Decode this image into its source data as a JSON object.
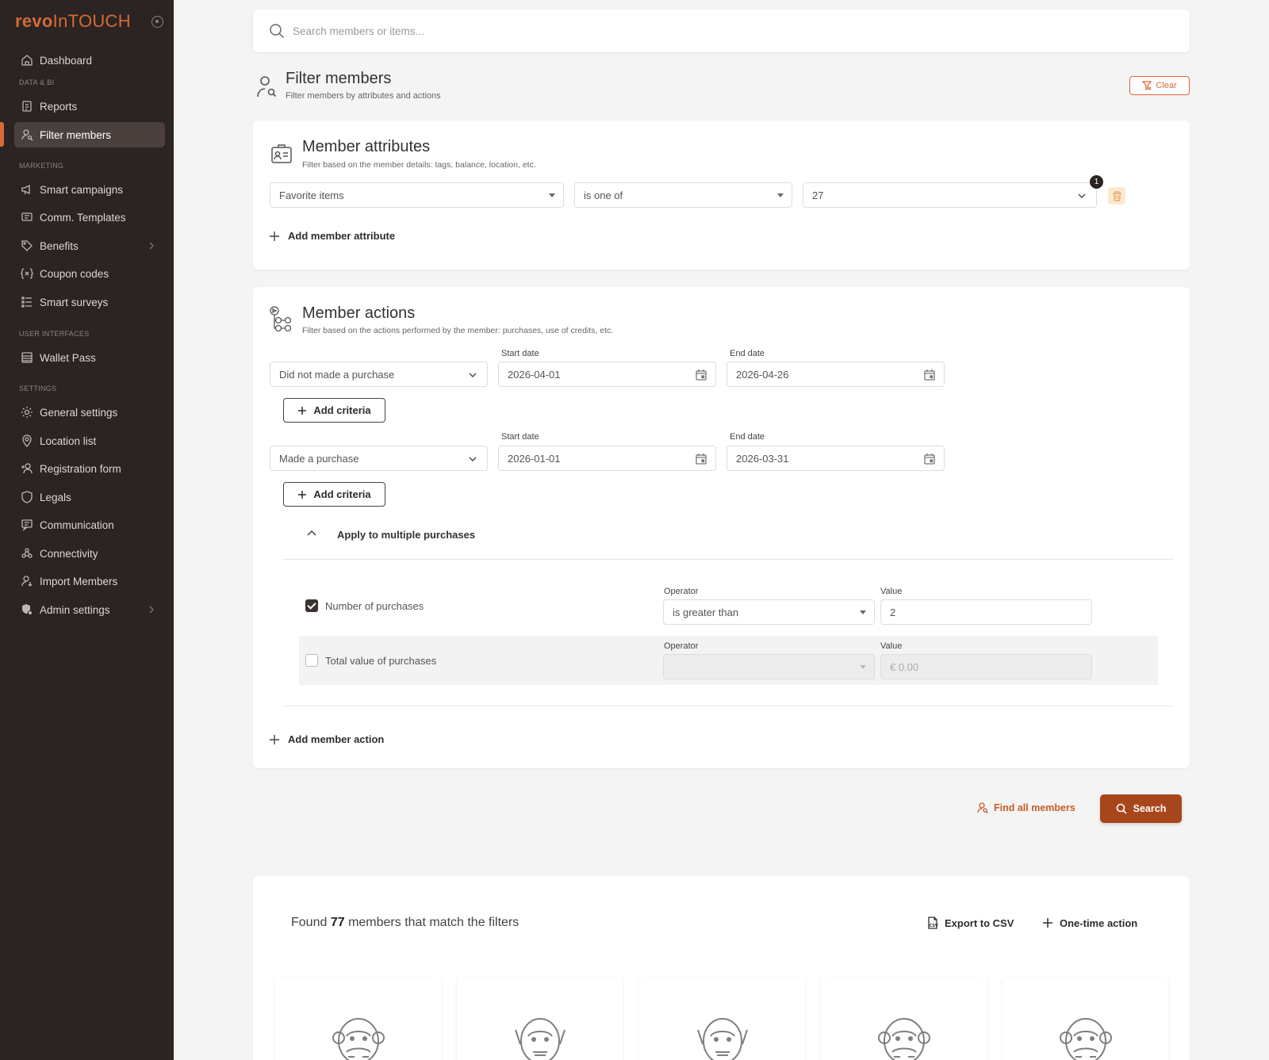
{
  "brand": {
    "part1": "revo",
    "part2": "InTOUCH"
  },
  "sidebar": {
    "dashboard": "Dashboard",
    "section_data": "DATA & BI",
    "reports": "Reports",
    "filter_members": "Filter members",
    "section_marketing": "MARKETING",
    "smart_campaigns": "Smart campaigns",
    "comm_templates": "Comm. Templates",
    "benefits": "Benefits",
    "coupon_codes": "Coupon codes",
    "smart_surveys": "Smart surveys",
    "section_ui": "USER INTERFACES",
    "wallet_pass": "Wallet Pass",
    "section_settings": "SETTINGS",
    "general_settings": "General settings",
    "location_list": "Location list",
    "registration_form": "Registration form",
    "legals": "Legals",
    "communication": "Communication",
    "connectivity": "Connectivity",
    "import_members": "Import Members",
    "admin_settings": "Admin settings"
  },
  "search": {
    "placeholder": "Search members or items..."
  },
  "page": {
    "title": "Filter members",
    "subtitle": "Filter members by attributes and actions",
    "clear_label": "Clear"
  },
  "attributes": {
    "title": "Member attributes",
    "subtitle": "Filter based on the member details: tags, balance, location, etc.",
    "field": "Favorite items",
    "operator": "is one of",
    "value": "27",
    "count_badge": "1",
    "add_label": "Add member attribute"
  },
  "actions": {
    "title": "Member actions",
    "subtitle": "Filter based on the actions performed by the member: purchases, use of credits, etc.",
    "start_label": "Start date",
    "end_label": "End date",
    "row1": {
      "action": "Did not made a purchase",
      "start": "2026-04-01",
      "end": "2026-04-26"
    },
    "row2": {
      "action": "Made a purchase",
      "start": "2026-01-01",
      "end": "2026-03-31"
    },
    "add_criteria": "Add criteria",
    "multi_label": "Apply to multiple purchases",
    "operator_label": "Operator",
    "value_label": "Value",
    "num_purchases": {
      "label": "Number of purchases",
      "checked": true,
      "operator": "is greater than",
      "value": "2"
    },
    "total_value": {
      "label": "Total value of purchases",
      "checked": false,
      "operator": "",
      "placeholder": "€ 0.00"
    },
    "add_label": "Add member action"
  },
  "footer_actions": {
    "find_all": "Find all members",
    "search": "Search"
  },
  "results": {
    "prefix": "Found",
    "count": "77",
    "suffix": "members that match the filters",
    "export": "Export to CSV",
    "one_time": "One-time action"
  },
  "colors": {
    "accent": "#d66a35",
    "sidebar_bg": "#2b2423",
    "primary_button": "#a8461b"
  }
}
